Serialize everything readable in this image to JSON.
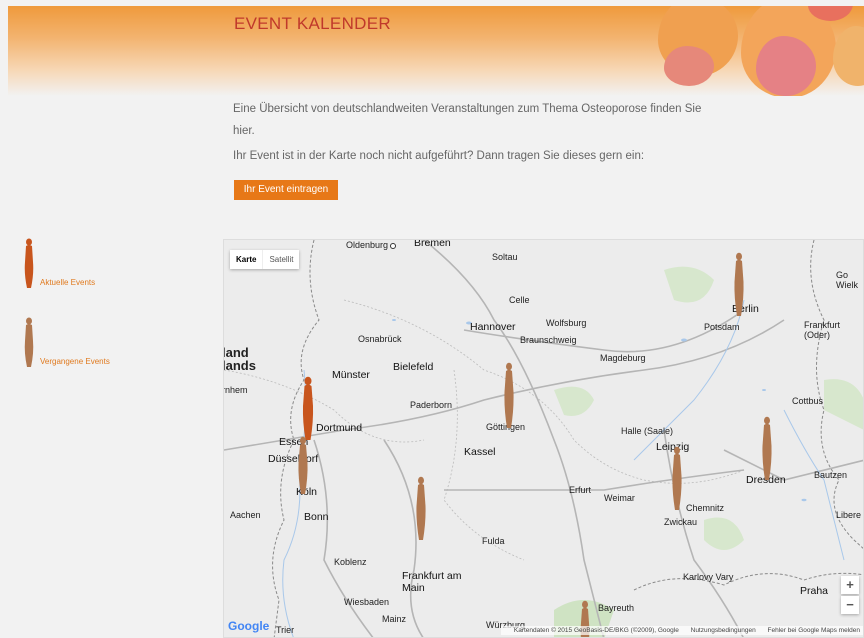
{
  "page": {
    "title": "EVENT KALENDER",
    "intro": "Eine Übersicht von deutschlandweiten Veranstaltungen zum Thema Osteoporose finden Sie hier.",
    "cta_text": "Ihr Event ist in der Karte noch nicht aufgeführt? Dann tragen Sie dieses gern ein:",
    "cta_button": "Ihr Event eintragen"
  },
  "legend": {
    "current": "Aktuelle Events",
    "past": "Vergangene Events"
  },
  "colors": {
    "accent": "#e77817",
    "title": "#c0392b",
    "current_pin": "#c8551d",
    "past_pin": "#b07850"
  },
  "map": {
    "type_tabs": [
      "Karte",
      "Satellit"
    ],
    "zoom_in": "+",
    "zoom_out": "−",
    "logo": "Google",
    "attribution": "Kartendaten © 2015 GeoBasis-DE/BKG (©2009), Google",
    "terms": "Nutzungsbedingungen",
    "report": "Fehler bei Google Maps melden",
    "cities": {
      "oldenburg": "Oldenburg",
      "bremen": "Bremen",
      "soltau": "Soltau",
      "celle": "Celle",
      "hannover": "Hannover",
      "wolfsburg": "Wolfsburg",
      "osnabrueck": "Osnabrück",
      "braunschweig": "Braunschweig",
      "berlin": "Berlin",
      "potsdam": "Potsdam",
      "frankfurt_oder": "Frankfurt (Oder)",
      "magdeburg": "Magdeburg",
      "bielefeld": "Bielefeld",
      "muenster": "Münster",
      "niederlands": "land lands",
      "paderborn": "Paderborn",
      "dortmund": "Dortmund",
      "goettingen": "Göttingen",
      "essen": "Essen",
      "duesseldorf": "Düsseldorf",
      "kassel": "Kassel",
      "halle": "Halle (Saale)",
      "leipzig": "Leipzig",
      "cottbus": "Cottbus",
      "koeln": "Köln",
      "dresden": "Dresden",
      "bautzen": "Bautzen",
      "aachen": "Aachen",
      "bonn": "Bonn",
      "erfurt": "Erfurt",
      "weimar": "Weimar",
      "chemnitz": "Chemnitz",
      "zwickau": "Zwickau",
      "fulda": "Fulda",
      "koblenz": "Koblenz",
      "karlovy_vary": "Karlovy Vary",
      "frankfurt_main": "Frankfurt am Main",
      "wiesbaden": "Wiesbaden",
      "mainz": "Mainz",
      "bayreuth": "Bayreuth",
      "praha": "Praha",
      "wuerzburg": "Würzburg",
      "trier": "Trier",
      "liberec": "Libere",
      "goerlitz": "Go Wielk",
      "arnhem": "rnhem"
    }
  }
}
